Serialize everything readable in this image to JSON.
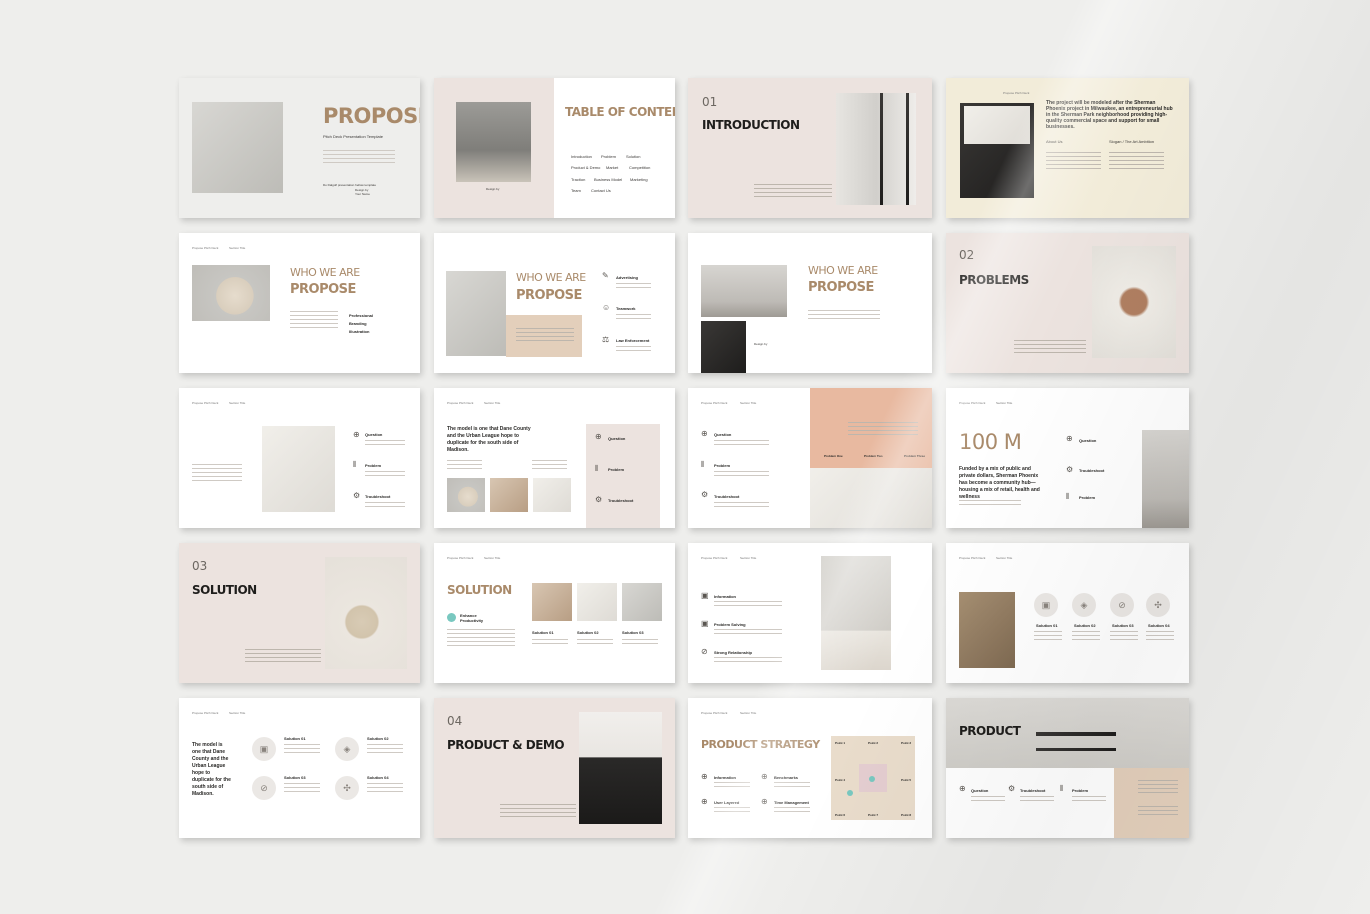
{
  "slides": {
    "s1": {
      "title": "PROPOSE",
      "subtitle": "Pitch Deck Presentation Template",
      "credit_left": "Do Dalgolf presentation hellow template",
      "credit_right": "Design by",
      "credit_right2": "Your Name"
    },
    "s2": {
      "title": "TABLE OF CONTENT",
      "items": [
        "Introduction",
        "Problem",
        "Solution",
        "Product & Demo",
        "Market",
        "Competition",
        "Traction",
        "Business Model",
        "Marketing",
        "Team",
        "Contact Us"
      ],
      "credit_right": "Design by"
    },
    "s3": {
      "number": "01",
      "title": "INTRODUCTION"
    },
    "s4": {
      "quote": "The project will be modeled after the Sherman Phoenix project in Milwaukee, an entrepreneurial hub in the Sherman Park neighborhood providing high-quality commercial space and support for small businesses.",
      "col1": "About Us",
      "col2": "Slogan / The Art Ambition",
      "hdr": "Propose Pitch Deck"
    },
    "s5": {
      "title_line1": "WHO WE ARE",
      "title_line2": "PROPOSE",
      "tags": [
        "Professional",
        "Branding",
        "Illustration"
      ]
    },
    "s6": {
      "title_line1": "WHO WE ARE",
      "title_line2": "PROPOSE",
      "items": [
        "Advertising",
        "Teamwork",
        "Law Enforcement"
      ]
    },
    "s7": {
      "title_line1": "WHO WE ARE",
      "title_line2": "PROPOSE",
      "caption": "Design by"
    },
    "s8": {
      "number": "02",
      "title": "PROBLEMS"
    },
    "s9": {
      "items": [
        "Question",
        "Problem",
        "Troubleshoot"
      ]
    },
    "s10": {
      "quote": "The model is one that Dane County and the Urban League hope to duplicate for the south side of Madison.",
      "items": [
        "Question",
        "Problem",
        "Troubleshoot"
      ]
    },
    "s11": {
      "items": [
        "Question",
        "Problem",
        "Troubleshoot"
      ],
      "labels": [
        "Problem One",
        "Problem Two",
        "Problem Three"
      ]
    },
    "s12": {
      "big": "100 M",
      "quote": "Funded by a mix of public and private dollars, Sherman Phoenix has become a community hub—housing a mix of retail, health and wellness",
      "items": [
        "Question",
        "Troubleshoot",
        "Problem"
      ]
    },
    "s13": {
      "number": "03",
      "title": "SOLUTION"
    },
    "s14": {
      "title": "SOLUTION",
      "badge": "Enhance Productivity",
      "labels": [
        "Solution 01",
        "Solution 02",
        "Solution 03"
      ]
    },
    "s15": {
      "items": [
        "Information",
        "Problem Solving",
        "Strong Relationship"
      ]
    },
    "s16": {
      "labels": [
        "Solution 01",
        "Solution 02",
        "Solution 03",
        "Solution 04"
      ]
    },
    "s17": {
      "quote": "The model is one that Dane County and the Urban League hope to duplicate for the south side of Madison.",
      "labels": [
        "Solution 01",
        "Solution 02",
        "Solution 03",
        "Solution 04"
      ]
    },
    "s18": {
      "number": "04",
      "title": "PRODUCT & DEMO"
    },
    "s19": {
      "title": "PRODUCT STRATEGY",
      "items": [
        "Information",
        "Benchmarks",
        "User Layered",
        "Time Management"
      ],
      "points": [
        "Point 1",
        "Point 2",
        "Point 3",
        "Point 4",
        "Point 5",
        "Point 6",
        "Point 7",
        "Point 8"
      ]
    },
    "s20": {
      "title": "PRODUCT",
      "items": [
        "Question",
        "Troubleshoot",
        "Problem"
      ]
    }
  },
  "common": {
    "hdr_left": "Propose Pitch Deck",
    "hdr_mid": "Section Title"
  },
  "colors": {
    "gold": "#a98a6a",
    "beige": "#ece3df",
    "cream": "#f2ecd9",
    "peach": "#e8b9a0",
    "teal": "#79c8c0"
  }
}
